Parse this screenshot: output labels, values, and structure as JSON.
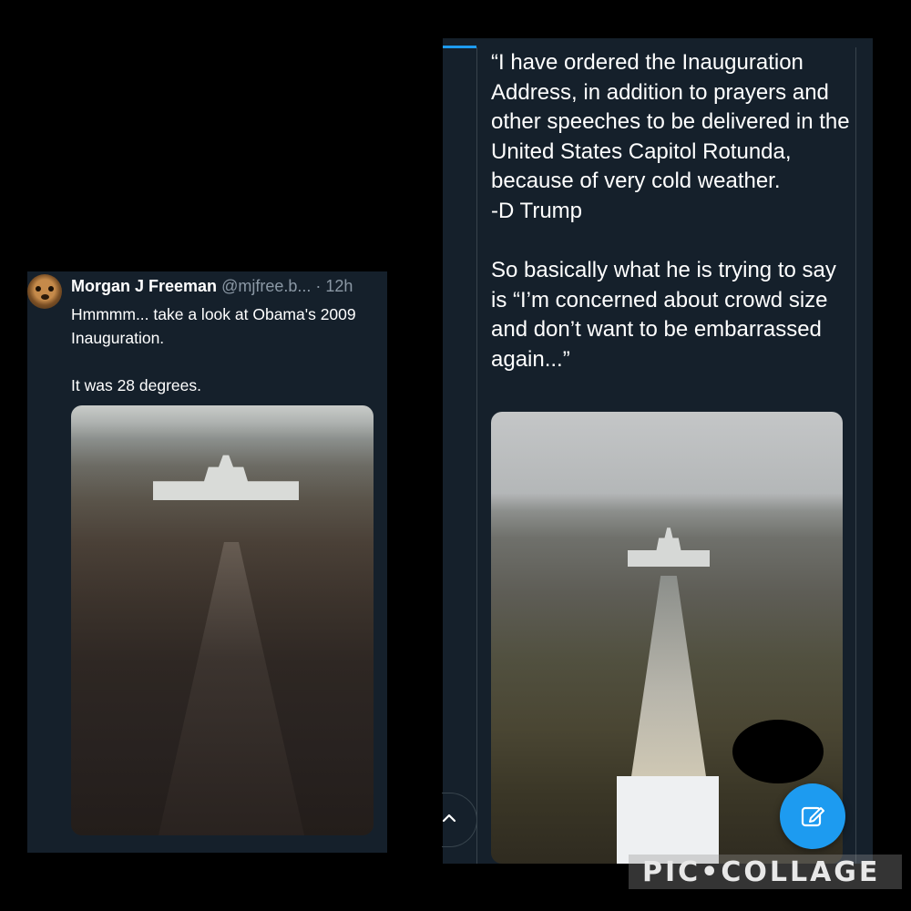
{
  "left_tweet": {
    "author_name": "Morgan J Freeman",
    "handle": "@mjfree.b...",
    "time": "· 12h",
    "text_line_1": "Hmmmm... take a look at Obama's 2009 Inauguration.",
    "text_line_2": "It was 28 degrees."
  },
  "right_tweet": {
    "quote_text": "“I have ordered the Inauguration Address, in addition to prayers and other speeches to be delivered in the United States Capitol Rotunda, because of very cold weather.",
    "attribution": "-D Trump",
    "commentary": "So basically what he is trying to say is “I’m concerned about crowd size and don’t want to be embarrassed again...”"
  },
  "controls": {
    "scroll_up_icon": "chevron-up-icon",
    "compose_icon": "compose-icon",
    "accent_color": "#1d9bf0"
  },
  "watermark": {
    "text": "PIC•COLLAGE"
  }
}
